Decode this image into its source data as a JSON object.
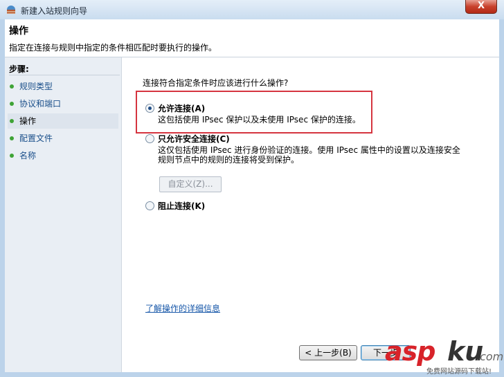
{
  "window": {
    "title": "新建入站规则向导",
    "close_label": "X"
  },
  "header": {
    "title": "操作",
    "description": "指定在连接与规则中指定的条件相匹配时要执行的操作。"
  },
  "sidebar": {
    "title": "步骤:",
    "items": [
      {
        "label": "规则类型",
        "active": false
      },
      {
        "label": "协议和端口",
        "active": false
      },
      {
        "label": "操作",
        "active": true
      },
      {
        "label": "配置文件",
        "active": false
      },
      {
        "label": "名称",
        "active": false
      }
    ]
  },
  "main": {
    "question": "连接符合指定条件时应该进行什么操作?",
    "options": [
      {
        "label": "允许连接(A)",
        "desc": "这包括使用 IPsec 保护以及未使用 IPsec 保护的连接。",
        "checked": true
      },
      {
        "label": "只允许安全连接(C)",
        "desc": "这仅包括使用 IPsec 进行身份验证的连接。使用 IPsec 属性中的设置以及连接安全规则节点中的规则的连接将受到保护。",
        "checked": false
      },
      {
        "label": "阻止连接(K)",
        "desc": "",
        "checked": false
      }
    ],
    "custom_button": "自定义(Z)...",
    "learn_link": "了解操作的详细信息"
  },
  "footer": {
    "back": "< 上一步(B)",
    "next": "下一步"
  },
  "watermark": {
    "brand_red": "asp",
    "brand_dark": "ku",
    "suffix": ".com",
    "tagline": "免费网站源码下载站!"
  },
  "colors": {
    "highlight_border": "#d5343f",
    "step_dot": "#3fa336",
    "link": "#1556a8"
  }
}
